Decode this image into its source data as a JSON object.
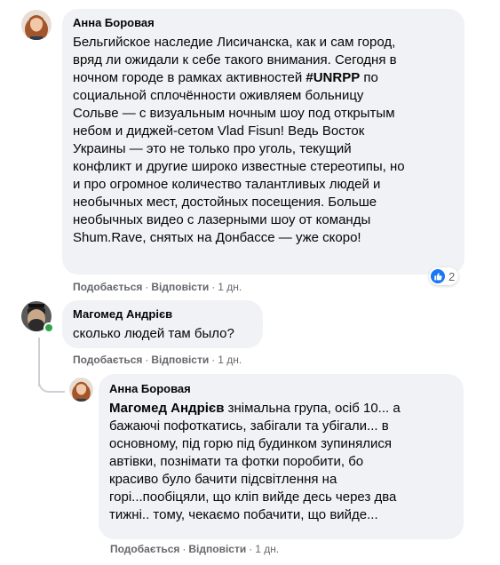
{
  "comments": [
    {
      "author": "Анна Боровая",
      "lines": [
        "Бельгийское наследие Лисичанска, как и сам город,",
        "вряд ли ожидали к себе такого внимания. Сегодня в",
        "ночном городе в рамках активностей ",
        "социальной сплочённости оживляем больницу",
        "Сольве — с визуальным ночным шоу под открытым",
        "небом и диджей-сетом Vlad Fisun! Ведь Восток",
        "Украины — это не только про уголь, текущий",
        "конфликт и другие широко известные стереотипы, но",
        "и про огромное количество талантливых людей и",
        "необычных мест, достойных посещения. Больше",
        "необычных видео с лазерными шоу от команды",
        "Shum.Rave, снятых на Донбассе — уже скоро!"
      ],
      "hashtag": "#UNRPP",
      "hashtag_after": " по",
      "like_label": "Подобається",
      "reply_label": "Відповісти",
      "time": "1 дн.",
      "reaction_count": "2"
    },
    {
      "author": "Магомед Андрієв",
      "text": "сколько людей там было?",
      "like_label": "Подобається",
      "reply_label": "Відповісти",
      "time": "1 дн."
    },
    {
      "author": "Анна Боровая",
      "mention": "Магомед Андрієв",
      "first_line_rest": " знімальна група, осіб 10... а",
      "lines": [
        "бажаючі пофоткатись, забігали та убігали... в",
        "основному, під горю під будинком зупинялися",
        "автівки, познімати та фотки поробити, бо",
        "красиво було бачити підсвітлення на",
        "горі...пообіцяли, що кліп вийде десь через два",
        "тижні.. тому, чекаємо побачити, що вийде..."
      ],
      "like_label": "Подобається",
      "reply_label": "Відповісти",
      "time": "1 дн."
    }
  ],
  "separator": "·",
  "colors": {
    "bubble": "#f0f2f5",
    "meta": "#65676b",
    "like": "#1877f2",
    "online": "#31a24c"
  },
  "icons": {
    "like": "thumbs-up-icon"
  }
}
